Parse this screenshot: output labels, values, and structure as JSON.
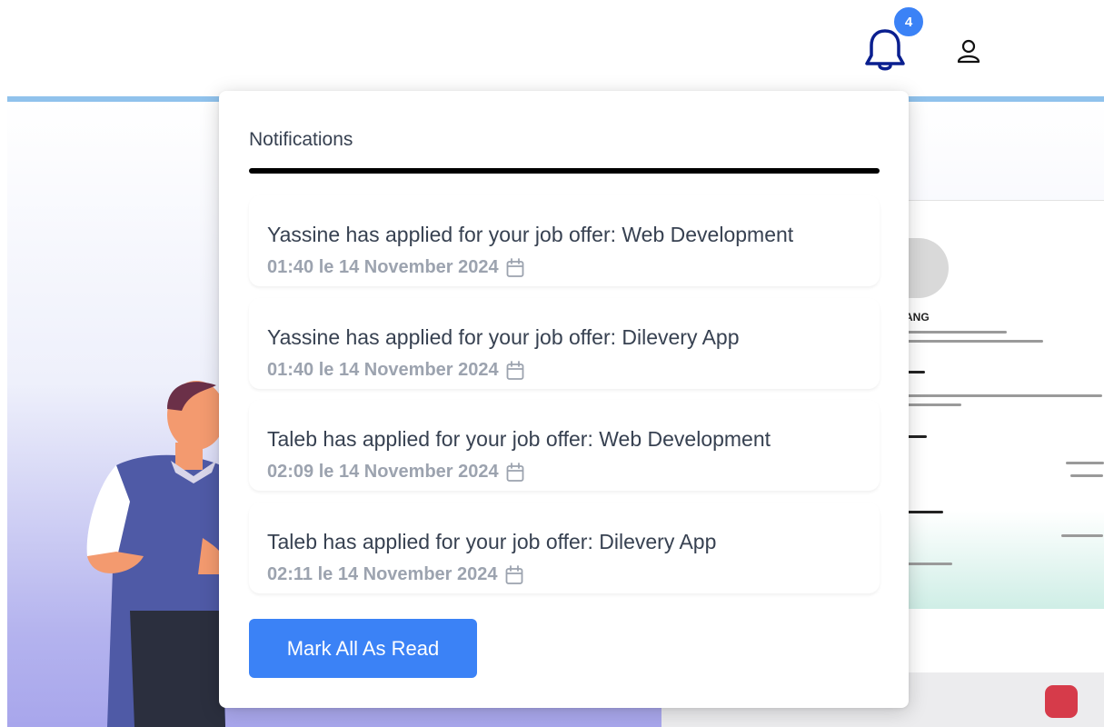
{
  "header": {
    "notification_count": "4",
    "bell_icon": "bell-icon",
    "user_icon": "user-icon",
    "colors": {
      "bell": "#0a1f8f",
      "badge": "#3b82f6",
      "accent_line": "#90c2ec"
    }
  },
  "hero": {
    "resume_name": "ANG"
  },
  "notifications": {
    "title": "Notifications",
    "items": [
      {
        "message": "Yassine has applied for your job offer: Web Development",
        "time": "01:40 le 14 November 2024"
      },
      {
        "message": "Yassine has applied for your job offer: Dilevery App",
        "time": "01:40 le 14 November 2024"
      },
      {
        "message": "Taleb has applied for your job offer: Web Development",
        "time": "02:09 le 14 November 2024"
      },
      {
        "message": "Taleb has applied for your job offer: Dilevery App",
        "time": "02:11 le 14 November 2024"
      }
    ],
    "mark_all_label": "Mark All As Read",
    "calendar_icon": "calendar-icon",
    "button_color": "#3b82f6"
  }
}
